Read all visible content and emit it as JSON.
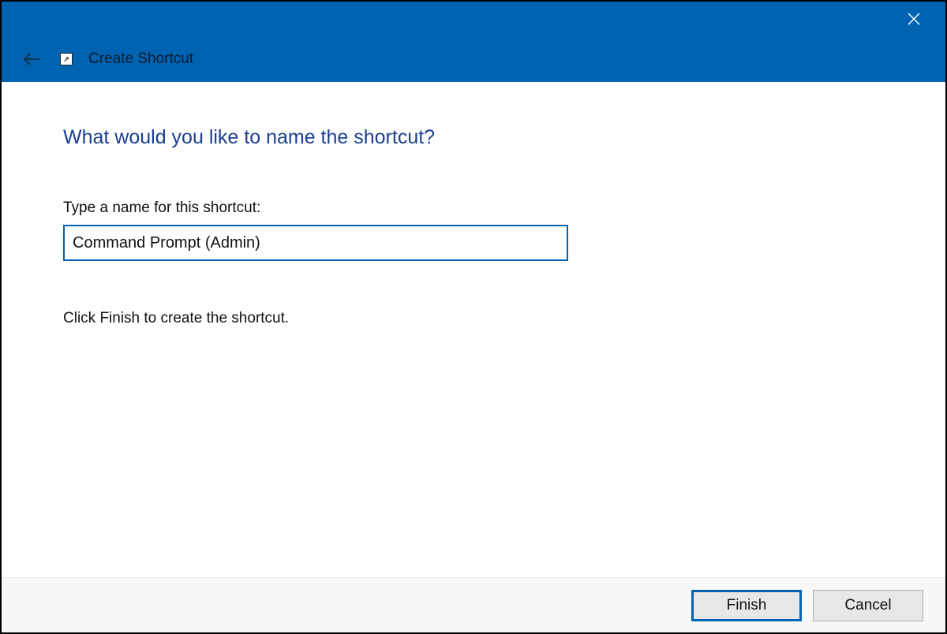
{
  "titlebar": {
    "close_icon": "close"
  },
  "header": {
    "back_icon": "arrow-left",
    "shortcut_icon": "↗",
    "title": "Create Shortcut"
  },
  "content": {
    "heading": "What would you like to name the shortcut?",
    "label": "Type a name for this shortcut:",
    "input_value": "Command Prompt (Admin)",
    "instruction": "Click Finish to create the shortcut."
  },
  "footer": {
    "finish_label": "Finish",
    "cancel_label": "Cancel"
  }
}
